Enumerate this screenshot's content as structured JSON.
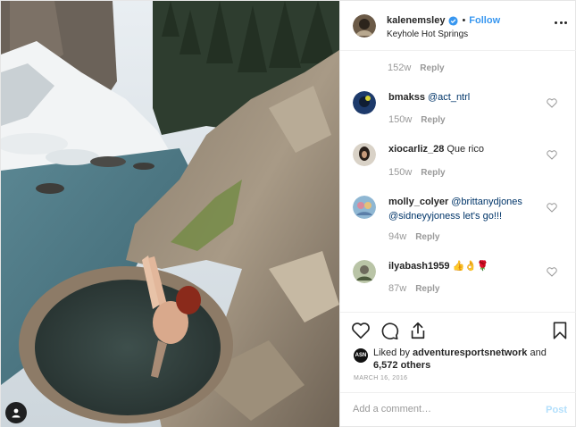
{
  "post": {
    "owner": {
      "username": "kalenemsley",
      "verified": true,
      "follow_label": "Follow",
      "separator": "•",
      "location": "Keyhole Hot Springs",
      "avatar_icon": "profile-avatar"
    },
    "more_icon": "more-options-icon",
    "photo": {
      "description_icon": "hot-spring-photo",
      "user_tag_icon": "user-tag-icon"
    },
    "comments": {
      "first_meta": {
        "time": "152w",
        "reply": "Reply"
      },
      "items": [
        {
          "username": "bmakss",
          "text": "@act_ntrl",
          "time": "150w",
          "reply": "Reply"
        },
        {
          "username": "xiocarliz_28",
          "text": "Que rico",
          "time": "150w",
          "reply": "Reply"
        },
        {
          "username": "molly_colyer",
          "text": "@brittanydjones @sidneyyjoness let's go!!!",
          "time": "94w",
          "reply": "Reply"
        },
        {
          "username": "ilyabash1959",
          "text": "👍👌🌹",
          "time": "87w",
          "reply": "Reply"
        }
      ]
    },
    "actions": {
      "like_icon": "heart-icon",
      "comment_icon": "comment-icon",
      "share_icon": "share-icon",
      "save_icon": "bookmark-icon"
    },
    "likes": {
      "prefix": "Liked by",
      "liker": "adventuresportsnetwork",
      "conjunction": "and",
      "others": "6,572 others",
      "avatar_text": "ASN"
    },
    "date": "MARCH 16, 2016",
    "add_comment": {
      "placeholder": "Add a comment…",
      "post_label": "Post"
    },
    "colors": {
      "link_blue": "#3897f0",
      "post_disabled": "#b2dffc",
      "muted": "#999999",
      "text": "#262626"
    }
  }
}
